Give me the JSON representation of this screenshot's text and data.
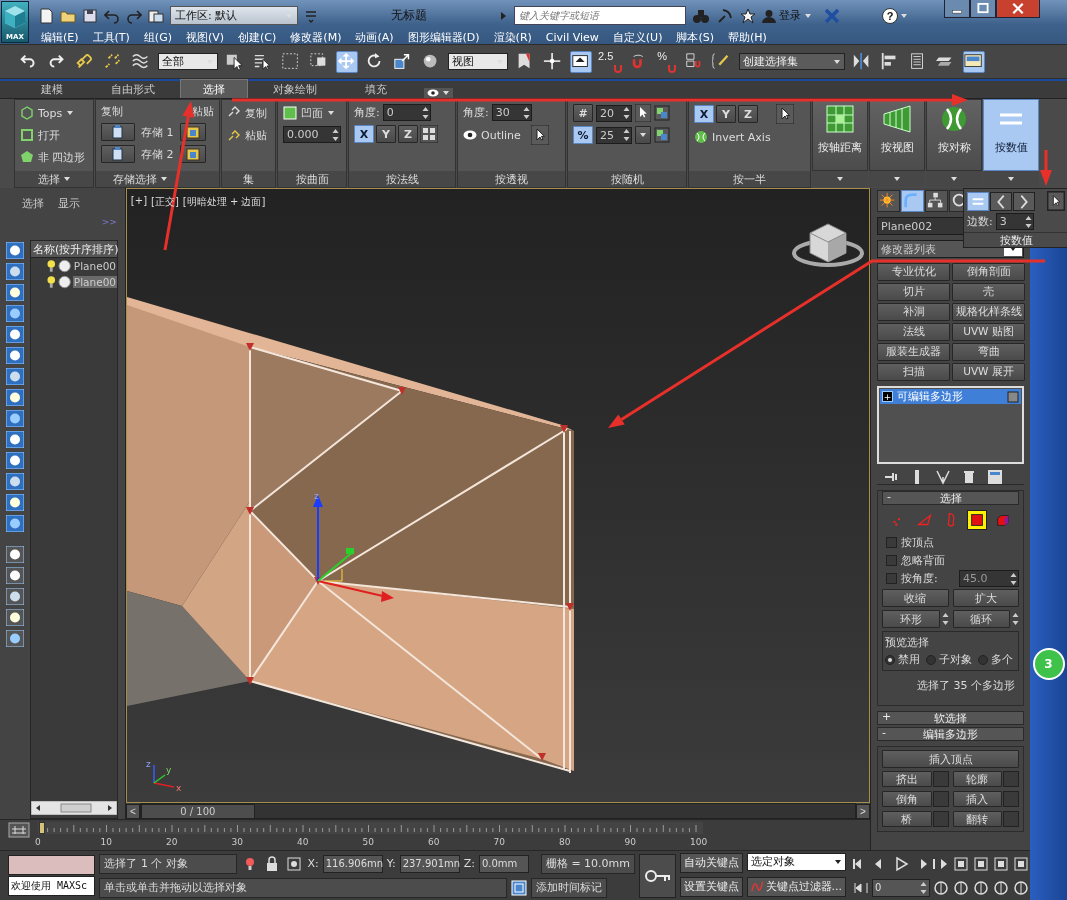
{
  "title_bar": {
    "app_button": "MAX",
    "workspace": "工作区: 默认",
    "title": "无标题",
    "search": {
      "placeholder": "键入关键字或短语"
    },
    "login": "登录",
    "help": "?"
  },
  "menu_bar": [
    "编辑(E)",
    "工具(T)",
    "组(G)",
    "视图(V)",
    "创建(C)",
    "修改器(M)",
    "动画(A)",
    "图形编辑器(D)",
    "渲染(R)",
    "Civil View",
    "自定义(U)",
    "脚本(S)",
    "帮助(H)"
  ],
  "main_toolbar": {
    "items": [
      {
        "kind": "undo",
        "selected": false
      },
      {
        "kind": "redo",
        "selected": false
      },
      {
        "kind": "link",
        "selected": false
      },
      {
        "kind": "unlink",
        "selected": false
      },
      {
        "kind": "bind",
        "selected": false
      },
      {
        "kind": "dropdown",
        "value": "全部"
      },
      {
        "kind": "select",
        "selected": false
      },
      {
        "kind": "select_by_name",
        "selected": false
      },
      {
        "kind": "region",
        "selected": false
      },
      {
        "kind": "crossing",
        "selected": false
      },
      {
        "kind": "move",
        "selected": true
      },
      {
        "kind": "rotate",
        "selected": false
      },
      {
        "kind": "scale",
        "selected": false
      },
      {
        "kind": "sphere",
        "selected": false
      },
      {
        "kind": "dropdown",
        "value": "视图"
      },
      {
        "kind": "flag",
        "selected": false
      },
      {
        "kind": "pivot",
        "selected": false
      },
      {
        "kind": "snap",
        "selected": true
      },
      {
        "kind": "text_snap",
        "label": "2.5"
      },
      {
        "kind": "angle_snap",
        "selected": false
      },
      {
        "kind": "text_snap",
        "label": "%"
      },
      {
        "kind": "spinner_snap",
        "selected": false
      },
      {
        "kind": "named_sets",
        "selected": false
      },
      {
        "kind": "dark_dropdown",
        "value": "创建选择集"
      },
      {
        "kind": "mirror",
        "selected": false
      },
      {
        "kind": "align",
        "selected": false
      },
      {
        "kind": "layers",
        "selected": false
      },
      {
        "kind": "stack",
        "selected": false
      },
      {
        "kind": "render",
        "selected": true
      }
    ]
  },
  "ribbon": {
    "tabs": [
      {
        "label": "建模",
        "selected": false
      },
      {
        "label": "自由形式",
        "selected": false
      },
      {
        "label": "选择",
        "selected": true
      },
      {
        "label": "对象绘制",
        "selected": false
      },
      {
        "label": "填充",
        "selected": false
      }
    ],
    "select_group": {
      "items": [
        "Tops",
        "打开",
        "非 四边形"
      ],
      "footer": "选择"
    },
    "stored_group": {
      "copy": "复制",
      "paste": "粘贴",
      "store": [
        "存储 1",
        "存储 2"
      ],
      "footer": "存储选择"
    },
    "sets_group": {
      "items": [
        "复制",
        "粘贴"
      ],
      "footer": "集"
    },
    "surface_group": {
      "mode": "凹面",
      "value": "0.000",
      "footer": "按曲面"
    },
    "normal_group": {
      "angle_label": "角度:",
      "angle": "0",
      "axes": [
        {
          "label": "X",
          "selected": true
        },
        {
          "label": "Y",
          "selected": false
        },
        {
          "label": "Z",
          "selected": false
        }
      ],
      "footer": "按法线"
    },
    "perspective_group": {
      "angle_label": "角度:",
      "angle": "30",
      "option": "Outline",
      "footer": "按透视"
    },
    "random_group": {
      "count_symbol": "#",
      "count": "20",
      "percent_symbol": "%",
      "percent": "25",
      "percent_selected": true,
      "footer": "按随机"
    },
    "half_group": {
      "axes": [
        {
          "label": "X",
          "selected": true
        },
        {
          "label": "Y",
          "selected": false
        },
        {
          "label": "Z",
          "selected": false
        }
      ],
      "option": "Invert Axis",
      "footer": "按一半"
    },
    "big_buttons": [
      {
        "kind": "distance",
        "label": "按轴距离",
        "selected": false
      },
      {
        "kind": "view",
        "label": "按视图",
        "selected": false
      },
      {
        "kind": "symmetry",
        "label": "按对称",
        "selected": false
      },
      {
        "kind": "numeric",
        "label": "按数值",
        "selected": true
      }
    ]
  },
  "popup": {
    "modes": [
      {
        "kind": "equal",
        "selected": true
      },
      {
        "kind": "less",
        "selected": false
      },
      {
        "kind": "greater",
        "selected": false
      }
    ],
    "edges_label": "边数:",
    "edges": "3",
    "title": "按数值"
  },
  "scene_explorer": {
    "tabs": [
      "选择",
      "显示"
    ],
    "expand": ">>",
    "column": "名称(按升序排序)",
    "rows": [
      {
        "name": "Plane00",
        "selected": false
      },
      {
        "name": "Plane00",
        "selected": true
      }
    ]
  },
  "viewport": {
    "labels": [
      "[+]",
      "[正交]",
      "[明暗处理 + 边面]"
    ],
    "gizmo_label": "z",
    "tripod_labels": [
      "z",
      "y",
      "x"
    ]
  },
  "time_slider": {
    "prev": "<",
    "position": "0 / 100",
    "next": ">",
    "level": 0,
    "ticks": [
      "0",
      "10",
      "20",
      "30",
      "40",
      "50",
      "60",
      "70",
      "80",
      "90",
      "100"
    ]
  },
  "command_panel": {
    "tabs": [
      {
        "kind": "create",
        "selected": false
      },
      {
        "kind": "modify",
        "selected": true
      },
      {
        "kind": "hierarchy",
        "selected": false
      },
      {
        "kind": "motion",
        "selected": false
      }
    ],
    "object_name": "Plane002",
    "modifier_list": "修改器列表",
    "modifiers": [
      "专业优化",
      "倒角剖面",
      "切片",
      "壳",
      "补洞",
      "规格化样条线",
      "法线",
      "UVW 贴图",
      "服装生成器",
      "弯曲",
      "扫描",
      "UVW 展开"
    ],
    "stack": [
      {
        "sign": "+",
        "name": "可编辑多边形",
        "selected": true
      }
    ],
    "selection_rollout": {
      "sign": "-",
      "title": "选择",
      "levels": [
        {
          "kind": "vertex",
          "selected": false
        },
        {
          "kind": "edge",
          "selected": false
        },
        {
          "kind": "border",
          "selected": false
        },
        {
          "kind": "polygon",
          "selected": true
        },
        {
          "kind": "element",
          "selected": false
        }
      ],
      "options": [
        {
          "label": "按顶点",
          "checked": false
        },
        {
          "label": "忽略背面",
          "checked": false
        },
        {
          "label": "按角度:",
          "checked": false
        }
      ],
      "angle": "45.0",
      "buttons": [
        "收缩",
        "扩大"
      ],
      "spin_buttons": [
        "环形",
        "循环"
      ],
      "preview": {
        "title": "预览选择",
        "options": [
          {
            "label": "禁用",
            "selected": true
          },
          {
            "label": "子对象",
            "selected": false
          },
          {
            "label": "多个",
            "selected": false
          }
        ]
      },
      "status": "选择了 35 个多边形"
    },
    "soft_rollout": {
      "sign": "+",
      "title": "软选择"
    },
    "edit_rollout": {
      "sign": "-",
      "title": "编辑多边形",
      "insert": "插入顶点",
      "buttons": [
        "挤出",
        "轮廓",
        "倒角",
        "插入",
        "桥",
        "翻转"
      ]
    }
  },
  "status_bar": {
    "script_listener": "欢迎使用 MAXSc",
    "selection": "选择了 1 个 对象",
    "prompt": "单击或单击并拖动以选择对象",
    "x_label": "X:",
    "x": "116.906mn",
    "y_label": "Y:",
    "y": "237.901mn",
    "z_label": "Z:",
    "z": "0.0mm",
    "grid": "栅格 = 10.0mm",
    "add_time_tag": "添加时间标记",
    "auto_key": "自动关键点",
    "set_key": "设置关键点",
    "key_mode": "选定对象",
    "key_filters": "关键点过滤器...",
    "frame": "0"
  },
  "desktop": {
    "badge": "3"
  }
}
